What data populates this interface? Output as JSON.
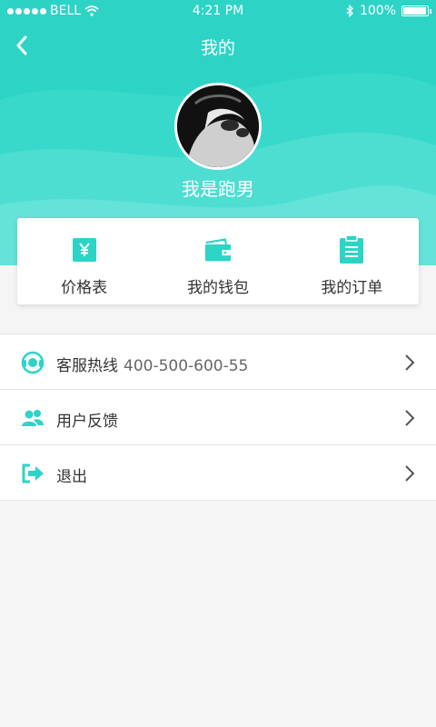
{
  "status_bar": {
    "carrier": "BELL",
    "time": "4:21 PM",
    "battery": "100%"
  },
  "nav": {
    "title": "我的"
  },
  "profile": {
    "username": "我是跑男"
  },
  "quick_actions": [
    {
      "label": "价格表",
      "icon": "yen-icon"
    },
    {
      "label": "我的钱包",
      "icon": "wallet-icon"
    },
    {
      "label": "我的订单",
      "icon": "order-list-icon"
    }
  ],
  "menu": [
    {
      "label": "客服热线",
      "value": "400-500-600-55",
      "icon": "headset-icon"
    },
    {
      "label": "用户反馈",
      "value": "",
      "icon": "users-icon"
    },
    {
      "label": "退出",
      "value": "",
      "icon": "logout-icon"
    }
  ],
  "colors": {
    "accent": "#2dd4c6",
    "background": "#f5f5f5"
  }
}
